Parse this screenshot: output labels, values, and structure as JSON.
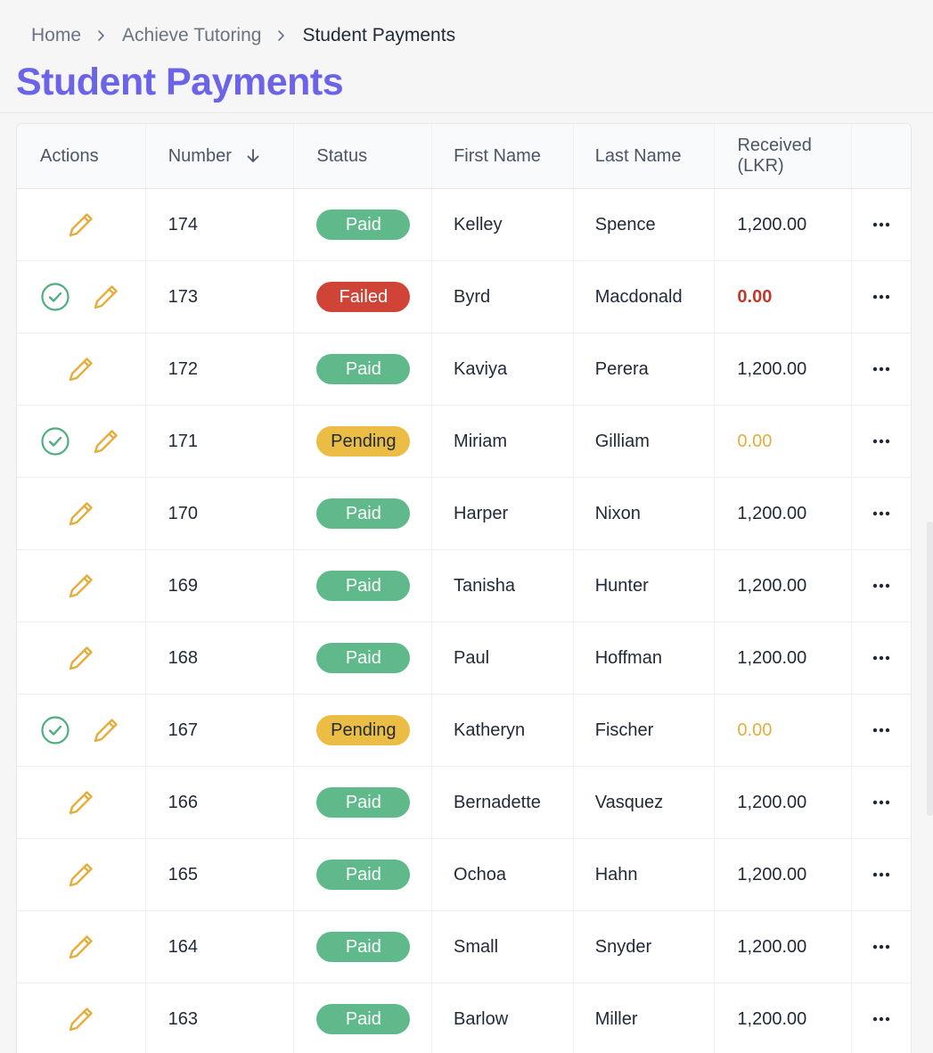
{
  "breadcrumb": {
    "items": [
      "Home",
      "Achieve Tutoring",
      "Student Payments"
    ]
  },
  "page": {
    "title": "Student Payments"
  },
  "colors": {
    "title": "#6b63e8",
    "paid": "#5fb98a",
    "failed": "#cf4436",
    "pending": "#ecbd45",
    "edit_icon": "#e5ae3c",
    "confirm_icon": "#4fae7e"
  },
  "table": {
    "columns": {
      "actions": "Actions",
      "number": "Number",
      "status": "Status",
      "first_name": "First Name",
      "last_name": "Last Name",
      "received": "Received (LKR)"
    },
    "sort": {
      "column": "number",
      "direction": "descending",
      "icon": "arrow-down-icon"
    },
    "rows": [
      {
        "number": "174",
        "status": "Paid",
        "first_name": "Kelley",
        "last_name": "Spence",
        "received": "1,200.00",
        "confirm": false
      },
      {
        "number": "173",
        "status": "Failed",
        "first_name": "Byrd",
        "last_name": "Macdonald",
        "received": "0.00",
        "confirm": true
      },
      {
        "number": "172",
        "status": "Paid",
        "first_name": "Kaviya",
        "last_name": "Perera",
        "received": "1,200.00",
        "confirm": false
      },
      {
        "number": "171",
        "status": "Pending",
        "first_name": "Miriam",
        "last_name": "Gilliam",
        "received": "0.00",
        "confirm": true
      },
      {
        "number": "170",
        "status": "Paid",
        "first_name": "Harper",
        "last_name": "Nixon",
        "received": "1,200.00",
        "confirm": false
      },
      {
        "number": "169",
        "status": "Paid",
        "first_name": "Tanisha",
        "last_name": "Hunter",
        "received": "1,200.00",
        "confirm": false
      },
      {
        "number": "168",
        "status": "Paid",
        "first_name": "Paul",
        "last_name": "Hoffman",
        "received": "1,200.00",
        "confirm": false
      },
      {
        "number": "167",
        "status": "Pending",
        "first_name": "Katheryn",
        "last_name": "Fischer",
        "received": "0.00",
        "confirm": true
      },
      {
        "number": "166",
        "status": "Paid",
        "first_name": "Bernadette",
        "last_name": "Vasquez",
        "received": "1,200.00",
        "confirm": false
      },
      {
        "number": "165",
        "status": "Paid",
        "first_name": "Ochoa",
        "last_name": "Hahn",
        "received": "1,200.00",
        "confirm": false
      },
      {
        "number": "164",
        "status": "Paid",
        "first_name": "Small",
        "last_name": "Snyder",
        "received": "1,200.00",
        "confirm": false
      },
      {
        "number": "163",
        "status": "Paid",
        "first_name": "Barlow",
        "last_name": "Miller",
        "received": "1,200.00",
        "confirm": false
      }
    ]
  }
}
